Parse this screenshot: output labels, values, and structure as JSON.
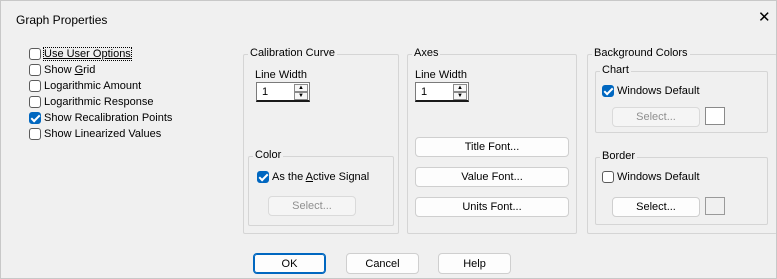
{
  "window": {
    "title": "Graph Properties",
    "close_glyph": "✕"
  },
  "options": [
    {
      "label_pre": "",
      "mnemonic": "Use User Options",
      "label_post": "",
      "checked": false,
      "all_underlined": true
    },
    {
      "label_pre": "Show ",
      "mnemonic": "G",
      "label_post": "rid",
      "checked": false
    },
    {
      "label_pre": "Logarithmic Amount",
      "mnemonic": "",
      "label_post": "",
      "checked": false
    },
    {
      "label_pre": "Logarithmic Response",
      "mnemonic": "",
      "label_post": "",
      "checked": false
    },
    {
      "label_pre": "Show Recalibration Points",
      "mnemonic": "",
      "label_post": "",
      "checked": true
    },
    {
      "label_pre": "Show Linearized Values",
      "mnemonic": "",
      "label_post": "",
      "checked": false
    }
  ],
  "calibration_curve": {
    "title": "Calibration Curve",
    "line_width_label": "Line Width",
    "line_width_value": "1",
    "color_group": {
      "title": "Color",
      "checkbox_pre": "As the ",
      "checkbox_mnemonic": "A",
      "checkbox_post": "ctive Signal",
      "checked": true,
      "select_label": "Select..."
    }
  },
  "axes": {
    "title": "Axes",
    "line_width_label": "Line Width",
    "line_width_value": "1",
    "buttons": [
      "Title Font...",
      "Value Font...",
      "Units Font..."
    ]
  },
  "background_colors": {
    "title": "Background Colors",
    "chart": {
      "title": "Chart",
      "checkbox_label": "Windows Default",
      "checked": true,
      "select_label": "Select...",
      "select_enabled": false
    },
    "border": {
      "title": "Border",
      "checkbox_label": "Windows Default",
      "checked": false,
      "select_label": "Select...",
      "select_enabled": true
    }
  },
  "footer": {
    "ok": "OK",
    "cancel": "Cancel",
    "help": "Help"
  },
  "colors": {
    "accent": "#0067c0",
    "dialog_bg": "#f0f0f0"
  }
}
